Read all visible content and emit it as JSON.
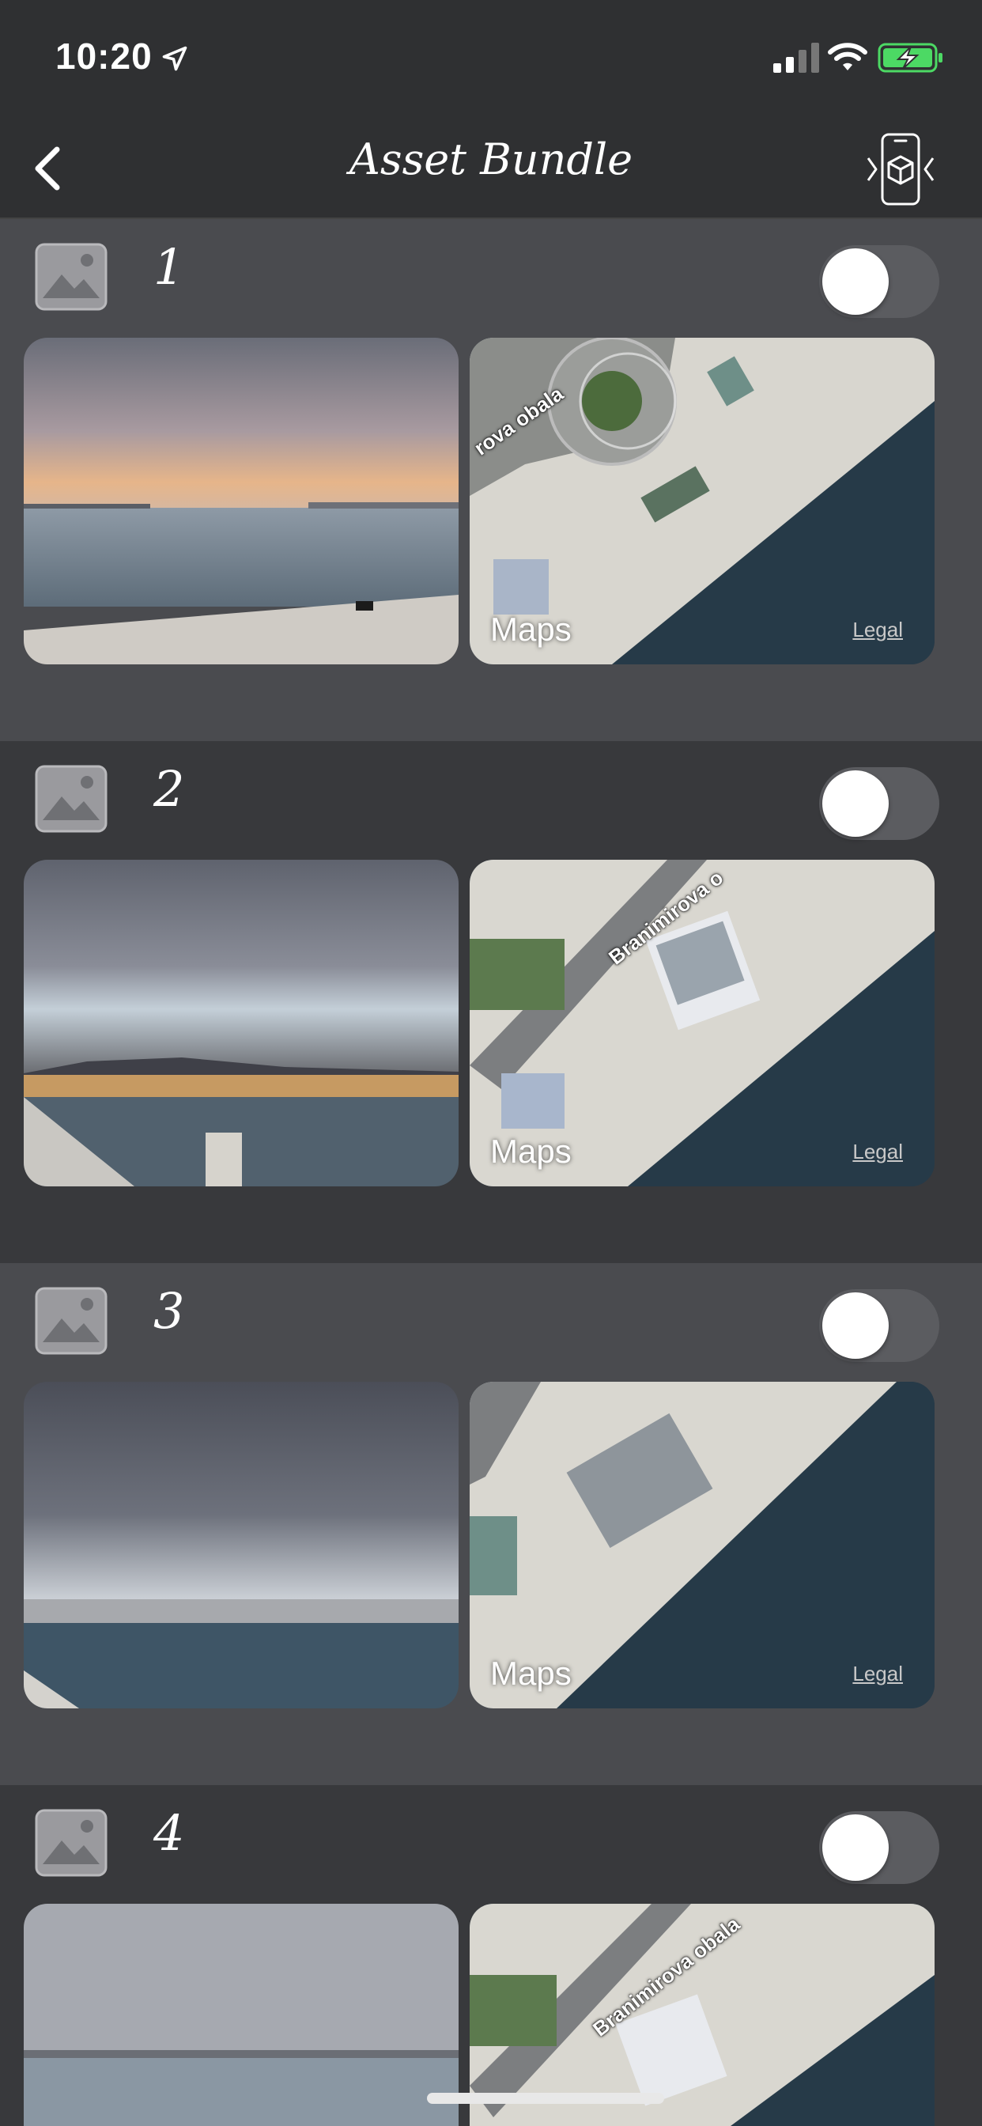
{
  "status_bar": {
    "time": "10:20",
    "icons": [
      "location-arrow-icon",
      "cellular-signal-icon",
      "wifi-icon",
      "battery-charging-icon"
    ],
    "battery_color": "#4cd964"
  },
  "nav": {
    "title": "Asset Bundle",
    "back_icon": "chevron-left-icon",
    "action_icon": "ar-phone-cube-icon"
  },
  "map_overlay": {
    "brand": "Maps",
    "legal": "Legal"
  },
  "items": [
    {
      "number": "1",
      "enabled": false,
      "photo": "sunset waterfront",
      "street": "rova obala"
    },
    {
      "number": "2",
      "enabled": false,
      "photo": "city skyline at dusk",
      "street": "Branimirova o"
    },
    {
      "number": "3",
      "enabled": false,
      "photo": "cloudy harbor",
      "street": ""
    },
    {
      "number": "4",
      "enabled": false,
      "photo": "overcast marina",
      "street": "Branimirova obala"
    }
  ],
  "colors": {
    "section_light": "#4a4b4f",
    "section_dark": "#38393c",
    "toggle_off": "#5b5c60",
    "water": "#283c4a"
  }
}
